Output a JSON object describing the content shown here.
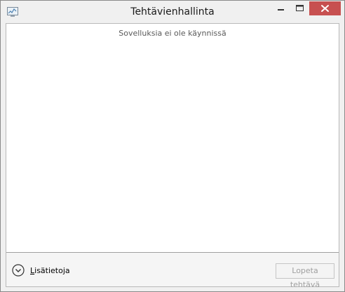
{
  "window": {
    "title": "Tehtävienhallinta"
  },
  "icons": {
    "app": "task-manager-icon",
    "minimize": "minimize-icon",
    "maximize": "maximize-icon",
    "close": "close-icon",
    "expand": "chevron-down-circle-icon"
  },
  "colors": {
    "close_button": "#c75050",
    "window_frame": "#f0f0f0"
  },
  "main": {
    "empty_message": "Sovelluksia ei ole käynnissä"
  },
  "footer": {
    "more_details_label": "Lisätietoja",
    "end_task_label": "Lopeta tehtävä"
  }
}
